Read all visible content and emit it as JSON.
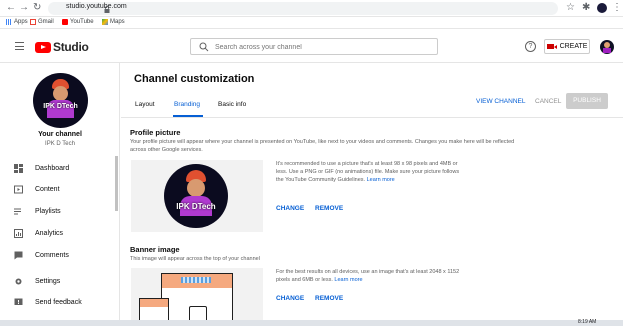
{
  "browser": {
    "url": "studio.youtube.com",
    "bookmarks": [
      "Apps",
      "Gmail",
      "YouTube",
      "Maps"
    ]
  },
  "header": {
    "logo_text": "Studio",
    "search_placeholder": "Search across your channel",
    "create_label": "CREATE",
    "help_glyph": "?"
  },
  "sidebar": {
    "channel_title": "Your channel",
    "channel_name": "IPK D Tech",
    "items": [
      {
        "label": "Dashboard",
        "icon": "dashboard-icon"
      },
      {
        "label": "Content",
        "icon": "content-icon"
      },
      {
        "label": "Playlists",
        "icon": "playlists-icon"
      },
      {
        "label": "Analytics",
        "icon": "analytics-icon"
      },
      {
        "label": "Comments",
        "icon": "comments-icon"
      },
      {
        "label": "Settings",
        "icon": "gear-icon"
      },
      {
        "label": "Send feedback",
        "icon": "feedback-icon"
      }
    ]
  },
  "main": {
    "title": "Channel customization",
    "tabs": [
      "Layout",
      "Branding",
      "Basic info"
    ],
    "active_tab": "Branding",
    "view_channel": "VIEW CHANNEL",
    "cancel": "CANCEL",
    "publish": "PUBLISH",
    "profile": {
      "title": "Profile picture",
      "desc": "Your profile picture will appear where your channel is presented on YouTube, like next to your videos and comments. Changes you make here will be reflected across other Google services.",
      "help": "It's recommended to use a picture that's at least 98 x 98 pixels and 4MB or less. Use a PNG or GIF (no animations) file. Make sure your picture follows the YouTube Community Guidelines.",
      "learn_more": "Learn more",
      "change": "CHANGE",
      "remove": "REMOVE",
      "avatar_text": "IPK DTech"
    },
    "banner": {
      "title": "Banner image",
      "desc": "This image will appear across the top of your channel",
      "help": "For the best results on all devices, use an image that's at least 2048 x 1152 pixels and 6MB or less.",
      "learn_more": "Learn more",
      "change": "CHANGE",
      "remove": "REMOVE"
    }
  },
  "taskbar": {
    "time": "8:19 AM"
  },
  "colors": {
    "accent": "#065fd4",
    "brand": "#ff0000"
  }
}
